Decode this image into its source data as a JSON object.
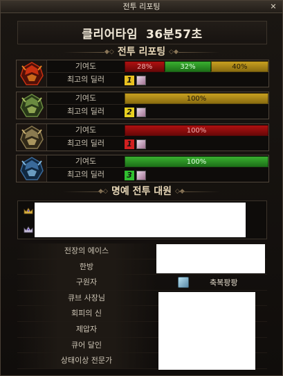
{
  "window": {
    "title": "전투 리포팅",
    "close_label": "✕"
  },
  "clear": {
    "label": "클리어타임",
    "time": "36분57초"
  },
  "battle_report": {
    "title": "전투 리포팅",
    "contribution_label": "기여도",
    "best_dealer_label": "최고의 딜러",
    "parties": [
      {
        "icon": "flame-helmet-icon",
        "segments": [
          {
            "value": "28%",
            "fraction": 0.28,
            "color": "red"
          },
          {
            "value": "32%",
            "fraction": 0.32,
            "color": "green"
          },
          {
            "value": "40%",
            "fraction": 0.4,
            "color": "yellow"
          }
        ],
        "dealer_rank": "1",
        "rank_color": "#e8c020"
      },
      {
        "icon": "green-horned-helmet-icon",
        "segments": [
          {
            "value": "100%",
            "fraction": 1.0,
            "color": "yellow"
          }
        ],
        "dealer_rank": "2",
        "rank_color": "#e8d020"
      },
      {
        "icon": "gold-horned-helmet-icon",
        "segments": [
          {
            "value": "100%",
            "fraction": 1.0,
            "color": "red"
          }
        ],
        "dealer_rank": "1",
        "rank_color": "#d02020"
      },
      {
        "icon": "blue-horned-helmet-icon",
        "segments": [
          {
            "value": "100%",
            "fraction": 1.0,
            "color": "green"
          }
        ],
        "dealer_rank": "3",
        "rank_color": "#30c030"
      }
    ]
  },
  "honor": {
    "title": "명예 전투 대원"
  },
  "awards": [
    {
      "label": "전장의 에이스",
      "value": ""
    },
    {
      "label": "한방",
      "value": ""
    },
    {
      "label": "구원자",
      "value": "축복팡팡"
    },
    {
      "label": "큐브 사장님",
      "value": ""
    },
    {
      "label": "회피의 신",
      "value": ""
    },
    {
      "label": "제압자",
      "value": ""
    },
    {
      "label": "큐어 달인",
      "value": ""
    },
    {
      "label": "상태이상 전문가",
      "value": ""
    }
  ],
  "colors": {
    "accent": "#e8d8b8",
    "bar_red": "#b01010",
    "bar_green": "#3ab030",
    "bar_yellow": "#c8a020"
  }
}
